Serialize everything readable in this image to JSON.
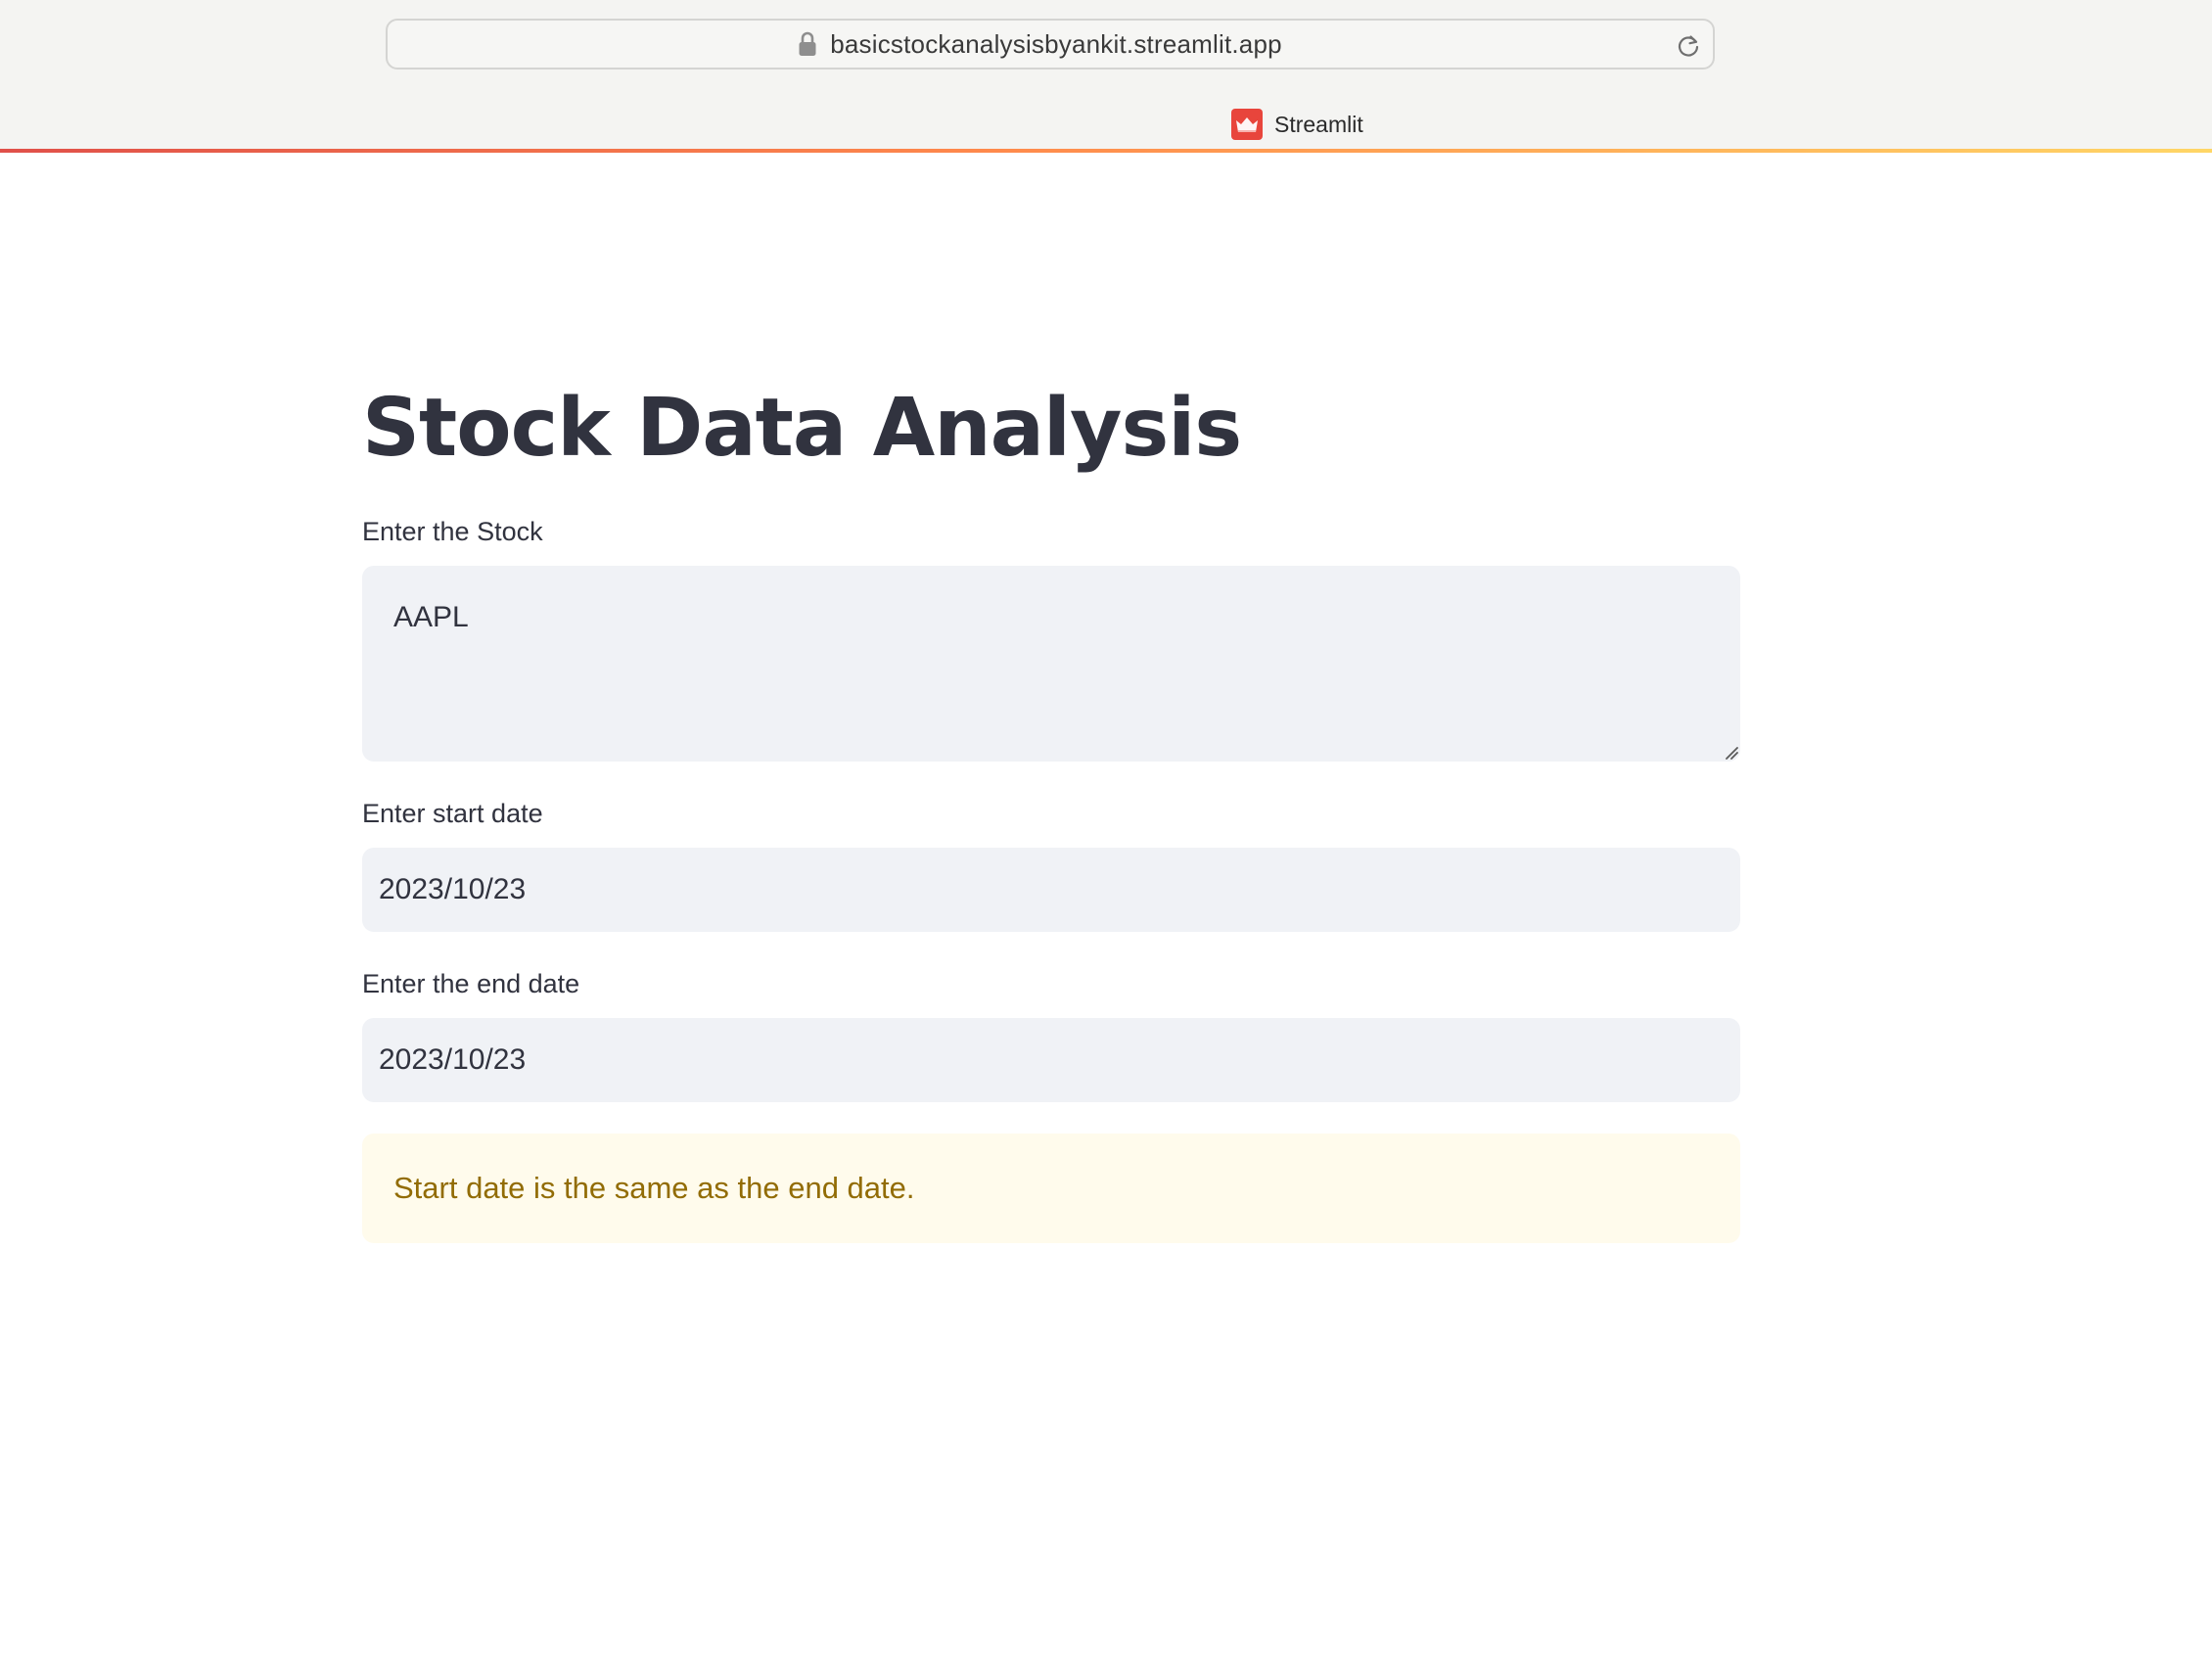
{
  "browser": {
    "url": "basicstockanalysisbyankit.streamlit.app",
    "tab_title": "Streamlit"
  },
  "colors": {
    "title": "#31333f",
    "input_background": "#f0f2f6",
    "warning_background": "#fffbec",
    "warning_text": "#926c05",
    "favicon": "#e8453c"
  },
  "page": {
    "title": "Stock Data Analysis"
  },
  "form": {
    "stock_label": "Enter the Stock",
    "stock_value": "AAPL",
    "start_date_label": "Enter start date",
    "start_date_value": "2023/10/23",
    "end_date_label": "Enter the end date",
    "end_date_value": "2023/10/23"
  },
  "alert": {
    "message": "Start date is the same as the end date."
  }
}
